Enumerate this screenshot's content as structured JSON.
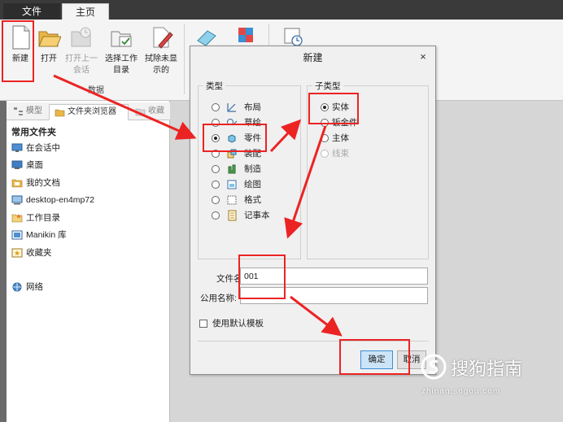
{
  "ribbon": {
    "tabs": [
      {
        "label": "文件",
        "active": false
      },
      {
        "label": "主页",
        "active": true
      }
    ],
    "buttons": [
      {
        "label": "新建",
        "icon": "new-document-icon",
        "enabled": true
      },
      {
        "label": "打开",
        "icon": "open-folder-icon",
        "enabled": true
      },
      {
        "label": "打开上一会话",
        "icon": "open-last-session-icon",
        "enabled": false
      },
      {
        "label": "选择工作目录",
        "icon": "select-working-directory-icon",
        "enabled": true
      },
      {
        "label": "拭除未显示的",
        "icon": "erase-not-displayed-icon",
        "enabled": true
      },
      {
        "label": "",
        "icon": "eraser-icon",
        "enabled": true
      },
      {
        "label": "",
        "icon": "color-blocks-icon",
        "enabled": true
      },
      {
        "label": "",
        "icon": "clock-settings-icon",
        "enabled": true
      }
    ],
    "group_label": "数据"
  },
  "left_panel": {
    "tabs": [
      {
        "label": "模型",
        "icon": "model-tree-icon"
      },
      {
        "label": "文件夹浏览器",
        "icon": "folder-browser-icon"
      },
      {
        "label": "收藏",
        "icon": "favorites-icon"
      }
    ],
    "header": "常用文件夹",
    "items": [
      {
        "label": "在会话中",
        "icon": "monitor-icon"
      },
      {
        "label": "桌面",
        "icon": "desktop-icon"
      },
      {
        "label": "我的文档",
        "icon": "documents-icon"
      },
      {
        "label": "desktop-en4mp72",
        "icon": "computer-icon"
      },
      {
        "label": "工作目录",
        "icon": "working-directory-icon"
      },
      {
        "label": "Manikin 库",
        "icon": "library-icon"
      },
      {
        "label": "收藏夹",
        "icon": "favorites-folder-icon"
      },
      {
        "label": "网络",
        "icon": "network-icon"
      }
    ]
  },
  "dialog": {
    "title": "新建",
    "close_glyph": "×",
    "type_legend": "类型",
    "types": [
      {
        "label": "布局",
        "icon": "layout-icon",
        "selected": false
      },
      {
        "label": "草绘",
        "icon": "sketch-icon",
        "selected": false
      },
      {
        "label": "零件",
        "icon": "part-icon",
        "selected": true
      },
      {
        "label": "装配",
        "icon": "assembly-icon",
        "selected": false
      },
      {
        "label": "制造",
        "icon": "manufacturing-icon",
        "selected": false
      },
      {
        "label": "绘图",
        "icon": "drawing-icon",
        "selected": false
      },
      {
        "label": "格式",
        "icon": "format-icon",
        "selected": false
      },
      {
        "label": "记事本",
        "icon": "notebook-icon",
        "selected": false
      }
    ],
    "subtype_legend": "子类型",
    "subtypes": [
      {
        "label": "实体",
        "selected": true,
        "enabled": true
      },
      {
        "label": "钣金件",
        "selected": false,
        "enabled": true
      },
      {
        "label": "主体",
        "selected": false,
        "enabled": true
      },
      {
        "label": "线束",
        "selected": false,
        "enabled": false
      }
    ],
    "filename_label": "文件名:",
    "filename_value": "001",
    "common_name_label": "公用名称:",
    "common_name_value": "",
    "use_template_label": "使用默认模板",
    "use_template_checked": false,
    "ok_label": "确定",
    "cancel_label": "取消"
  },
  "watermark": {
    "text": "搜狗指南",
    "url": "zhinan.sogou.com"
  },
  "colors": {
    "annotation_red": "#ec2323",
    "accent_blue": "#3c8fd6",
    "ribbon_dark": "#3a3a3a"
  }
}
